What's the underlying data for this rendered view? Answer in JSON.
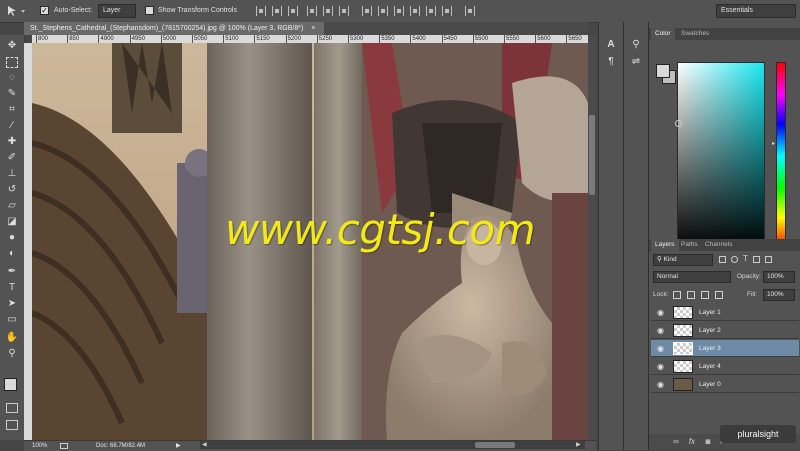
{
  "options_bar": {
    "auto_select_label": "Auto-Select:",
    "auto_select_value": "Layer",
    "show_transform_label": "Show Transform Controls",
    "workspace": "Essentials"
  },
  "document": {
    "tab_title": "St._Stephens_Cathedral_(Stephansdom)_(7815700254).jpg @ 100% (Layer 3, RGB/8*)",
    "close_glyph": "×"
  },
  "ruler_ticks": [
    "800",
    "850",
    "4900",
    "4950",
    "5000",
    "5050",
    "5100",
    "5150",
    "5200",
    "5250",
    "5300",
    "5350",
    "5400",
    "5450",
    "5500",
    "5550",
    "5600",
    "5650"
  ],
  "toolbar_tools": [
    "move-tool",
    "marquee-tool",
    "lasso-tool",
    "quick-select-tool",
    "crop-tool",
    "eyedropper-tool",
    "healing-tool",
    "brush-tool",
    "clone-stamp-tool",
    "history-brush-tool",
    "eraser-tool",
    "gradient-tool",
    "blur-tool",
    "dodge-tool",
    "pen-tool",
    "type-tool",
    "path-select-tool",
    "shape-tool",
    "hand-tool",
    "zoom-tool"
  ],
  "canvas": {
    "watermark": "www.cgtsj.com"
  },
  "status": {
    "zoom": "100%",
    "doc": "Doc: 68.7M/82.4M"
  },
  "color_panel": {
    "tabs": [
      "Color",
      "Swatches"
    ],
    "foreground": "#d9d9d9",
    "background": "#bfbfbf"
  },
  "layers_panel": {
    "tabs": [
      "Layers",
      "Paths",
      "Channels"
    ],
    "filter": "Kind",
    "blend_mode": "Normal",
    "opacity_label": "Opacity:",
    "opacity_value": "100%",
    "lock_label": "Lock:",
    "fill_label": "Fill:",
    "fill_value": "100%",
    "layers": [
      {
        "name": "Layer 1",
        "selected": false
      },
      {
        "name": "Layer 2",
        "selected": false
      },
      {
        "name": "Layer 3",
        "selected": true
      },
      {
        "name": "Layer 4",
        "selected": false
      },
      {
        "name": "Layer 0",
        "selected": false
      }
    ]
  },
  "branding": "pluralsight",
  "colors": {
    "watermark": "#f2ea12",
    "selected_layer": "#6d8aa6",
    "panel": "#535353"
  }
}
